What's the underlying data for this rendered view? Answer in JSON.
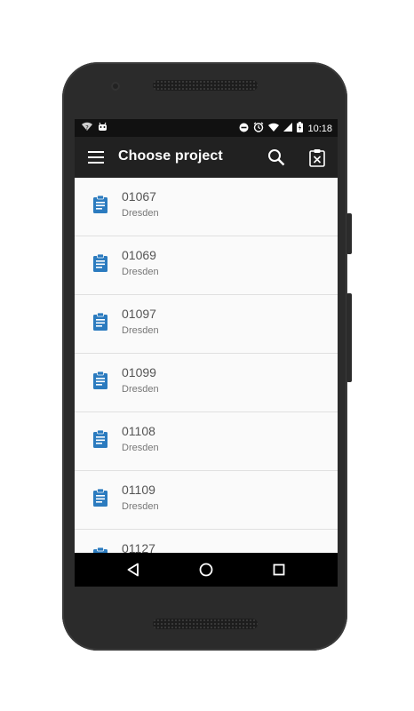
{
  "status_bar": {
    "time": "10:18",
    "icons": [
      "wifi-question-icon",
      "android-icon",
      "do-not-disturb-icon",
      "alarm-icon",
      "wifi-icon",
      "signal-icon",
      "battery-charging-icon"
    ]
  },
  "app_bar": {
    "title": "Choose project",
    "menu_icon": "hamburger-menu-icon",
    "search_icon": "search-icon",
    "clear_icon": "clipboard-close-icon"
  },
  "projects": [
    {
      "code": "01067",
      "city": "Dresden"
    },
    {
      "code": "01069",
      "city": "Dresden"
    },
    {
      "code": "01097",
      "city": "Dresden"
    },
    {
      "code": "01099",
      "city": "Dresden"
    },
    {
      "code": "01108",
      "city": "Dresden"
    },
    {
      "code": "01109",
      "city": "Dresden"
    },
    {
      "code": "01127",
      "city": ""
    }
  ],
  "nav_bar": {
    "back_icon": "back-triangle-icon",
    "home_icon": "home-circle-icon",
    "recents_icon": "recents-square-icon"
  },
  "colors": {
    "app_bar": "#212121",
    "accent_icon": "#2b7bbf",
    "list_background": "#fafafa"
  }
}
